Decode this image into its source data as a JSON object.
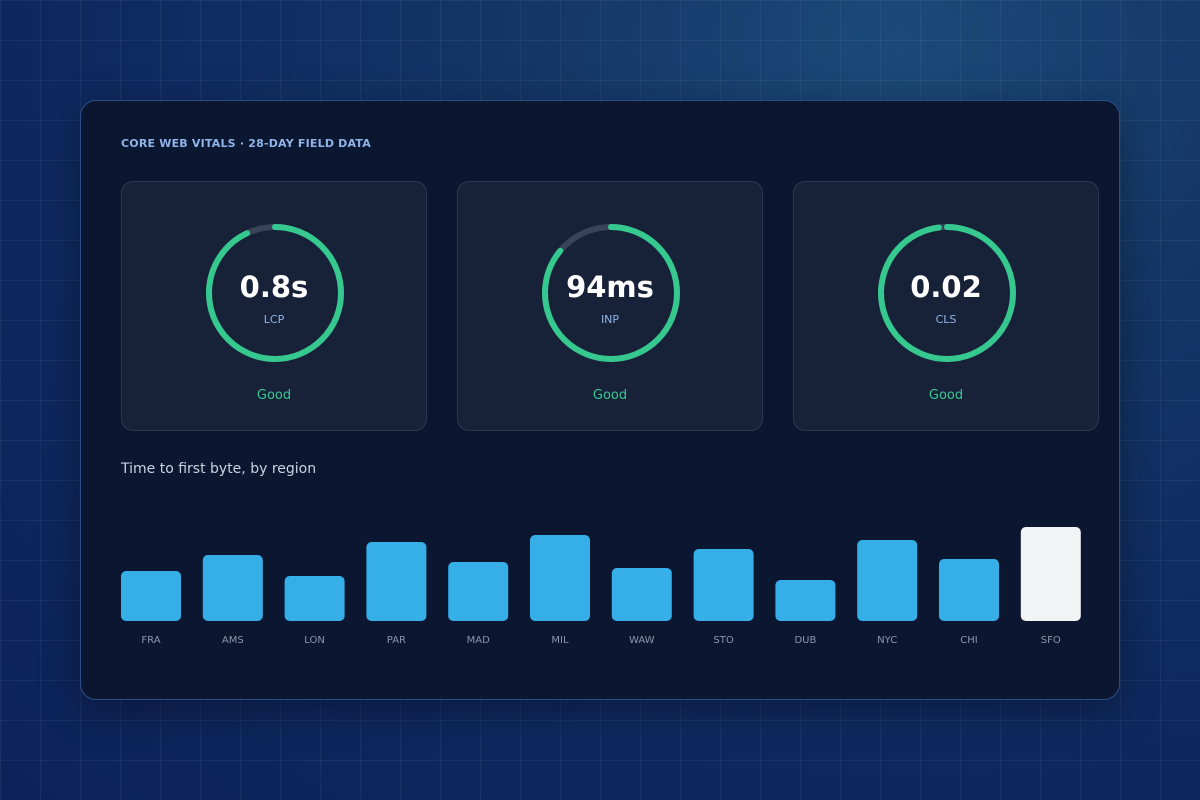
{
  "header": {
    "title": "CORE WEB VITALS · 28-DAY FIELD DATA"
  },
  "vitals": [
    {
      "value": "0.8s",
      "name": "LCP",
      "status": "Good",
      "progress": 0.93
    },
    {
      "value": "94ms",
      "name": "INP",
      "status": "Good",
      "progress": 0.86
    },
    {
      "value": "0.02",
      "name": "CLS",
      "status": "Good",
      "progress": 0.98
    }
  ],
  "colors": {
    "good": "#36c98f",
    "ring_track": "#3a4459",
    "bar": "#36aee8",
    "bar_highlight": "#f2f3f5"
  },
  "section": {
    "title": "Time to first byte, by region"
  },
  "chart_data": {
    "type": "bar",
    "categories": [
      "FRA",
      "AMS",
      "LON",
      "PAR",
      "MAD",
      "MIL",
      "WAW",
      "STO",
      "DUB",
      "NYC",
      "CHI",
      "SFO"
    ],
    "values": [
      50,
      66,
      45,
      79,
      59,
      86,
      53,
      72,
      41,
      81,
      62,
      94
    ],
    "ylim": [
      0,
      100
    ],
    "highlighted": "SFO",
    "grid": false,
    "legend": false
  }
}
